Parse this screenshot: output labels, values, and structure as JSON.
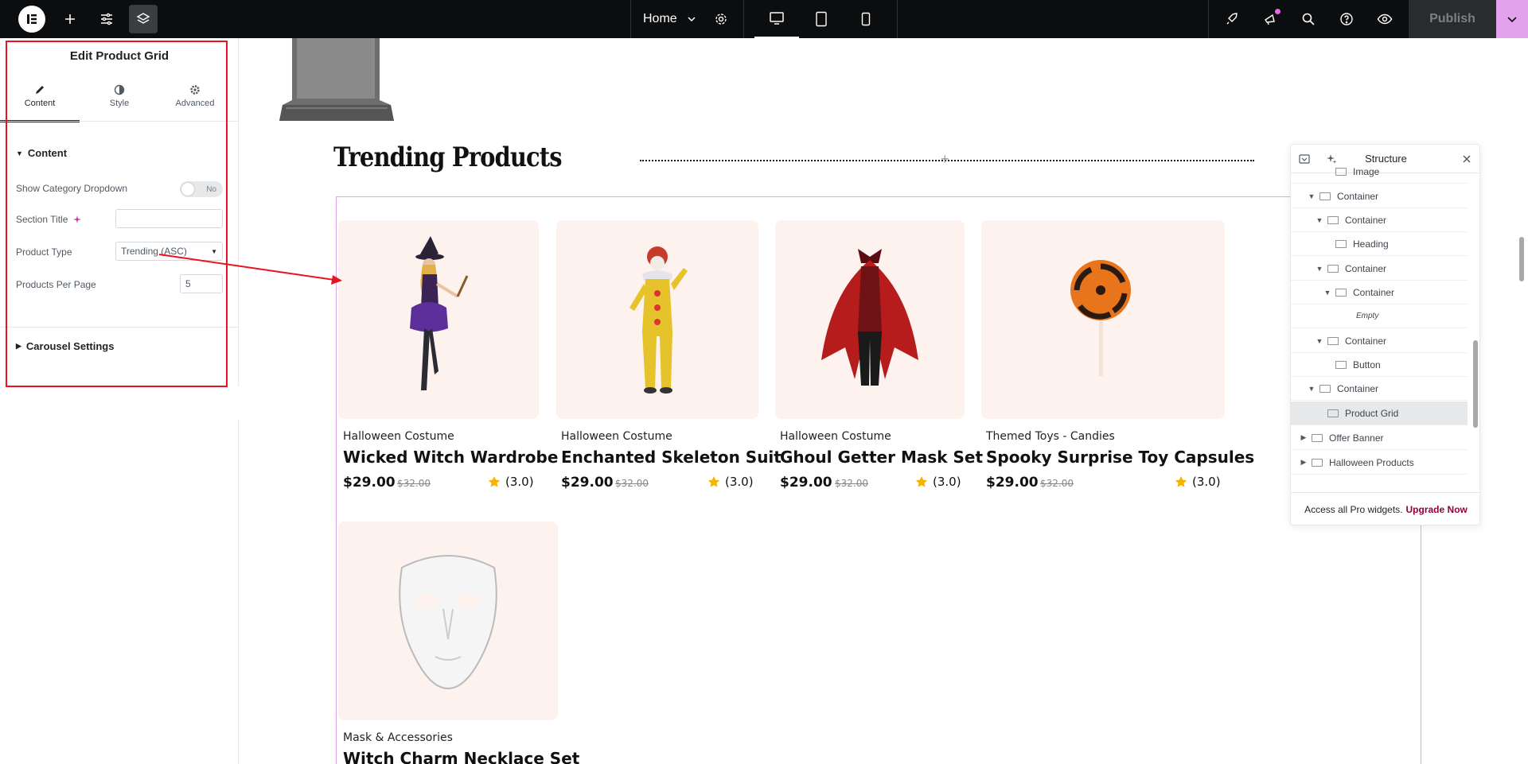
{
  "topbar": {
    "page_name": "Home",
    "publish_label": "Publish"
  },
  "panel": {
    "title": "Edit Product Grid",
    "tabs": [
      "Content",
      "Style",
      "Advanced"
    ],
    "content_section": "Content",
    "show_category_label": "Show Category Dropdown",
    "show_category_value": "No",
    "section_title_label": "Section Title",
    "section_title_value": "",
    "product_type_label": "Product Type",
    "product_type_value": "Trending (ASC)",
    "per_page_label": "Products Per Page",
    "per_page_value": "5",
    "carousel_section": "Carousel Settings"
  },
  "canvas": {
    "section_title": "Trending Products",
    "products": [
      {
        "category": "Halloween Costume",
        "name": "Wicked Witch Wardrobe",
        "price": "$29.00",
        "old_price": "$32.00",
        "rating": "(3.0)"
      },
      {
        "category": "Halloween Costume",
        "name": "Enchanted Skeleton Suit",
        "price": "$29.00",
        "old_price": "$32.00",
        "rating": "(3.0)"
      },
      {
        "category": "Halloween Costume",
        "name": "Ghoul Getter Mask Set",
        "price": "$29.00",
        "old_price": "$32.00",
        "rating": "(3.0)"
      },
      {
        "category": "Themed Toys - Candies",
        "name": "Spooky Surprise Toy Capsules",
        "price": "$29.00",
        "old_price": "$32.00",
        "rating": "(3.0)"
      },
      {
        "category": "Mask & Accessories",
        "name": "Witch Charm Necklace Set",
        "price": "",
        "old_price": "",
        "rating": ""
      }
    ]
  },
  "structure": {
    "title": "Structure",
    "rows": [
      {
        "label": "Image",
        "level": 3,
        "caret": ""
      },
      {
        "label": "Container",
        "level": 1,
        "caret": "▼"
      },
      {
        "label": "Container",
        "level": 2,
        "caret": "▼"
      },
      {
        "label": "Heading",
        "level": 3,
        "caret": ""
      },
      {
        "label": "Container",
        "level": 2,
        "caret": "▼"
      },
      {
        "label": "Container",
        "level": 3,
        "caret": "▼"
      },
      {
        "label": "Empty",
        "level": 4,
        "caret": ""
      },
      {
        "label": "Container",
        "level": 2,
        "caret": "▼"
      },
      {
        "label": "Button",
        "level": 3,
        "caret": ""
      },
      {
        "label": "Container",
        "level": 1,
        "caret": "▼"
      },
      {
        "label": "Product Grid",
        "level": 2,
        "caret": ""
      },
      {
        "label": "Offer Banner",
        "level": 0,
        "caret": "▶"
      },
      {
        "label": "Halloween Products",
        "level": 0,
        "caret": "▶"
      }
    ],
    "footer_text": "Access all Pro widgets.",
    "footer_link": "Upgrade Now"
  },
  "colors": {
    "accent": "#e2a3ec",
    "annotation_red": "#e8131f",
    "card_bg": "#fdf2ee",
    "star": "#f5b400",
    "to_top": "#f47a20"
  }
}
